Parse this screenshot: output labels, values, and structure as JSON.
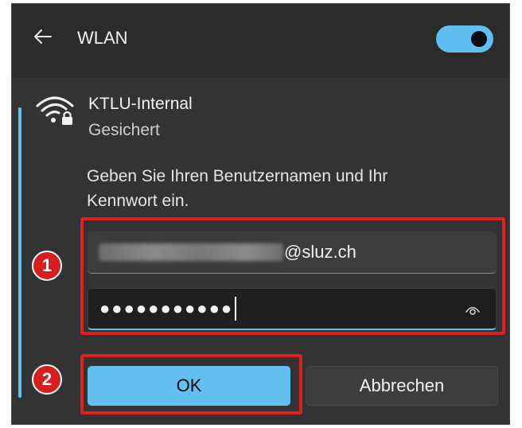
{
  "header": {
    "title": "WLAN",
    "back_icon": "back-arrow-icon",
    "wifi_toggle_on": true,
    "accent_color": "#60bff0"
  },
  "network": {
    "name": "KTLU-Internal",
    "status": "Gesichert",
    "icon": "wifi-secured-icon"
  },
  "prompt": "Geben Sie Ihren Benutzernamen und Ihr Kennwort ein.",
  "fields": {
    "username_suffix": "@sluz.ch",
    "password_mask": "●●●●●●●●●●●",
    "reveal_icon": "eye-icon"
  },
  "annotations": {
    "badge1": "1",
    "badge2": "2",
    "highlight_color": "#e02020"
  },
  "buttons": {
    "ok": "OK",
    "cancel": "Abbrechen"
  }
}
